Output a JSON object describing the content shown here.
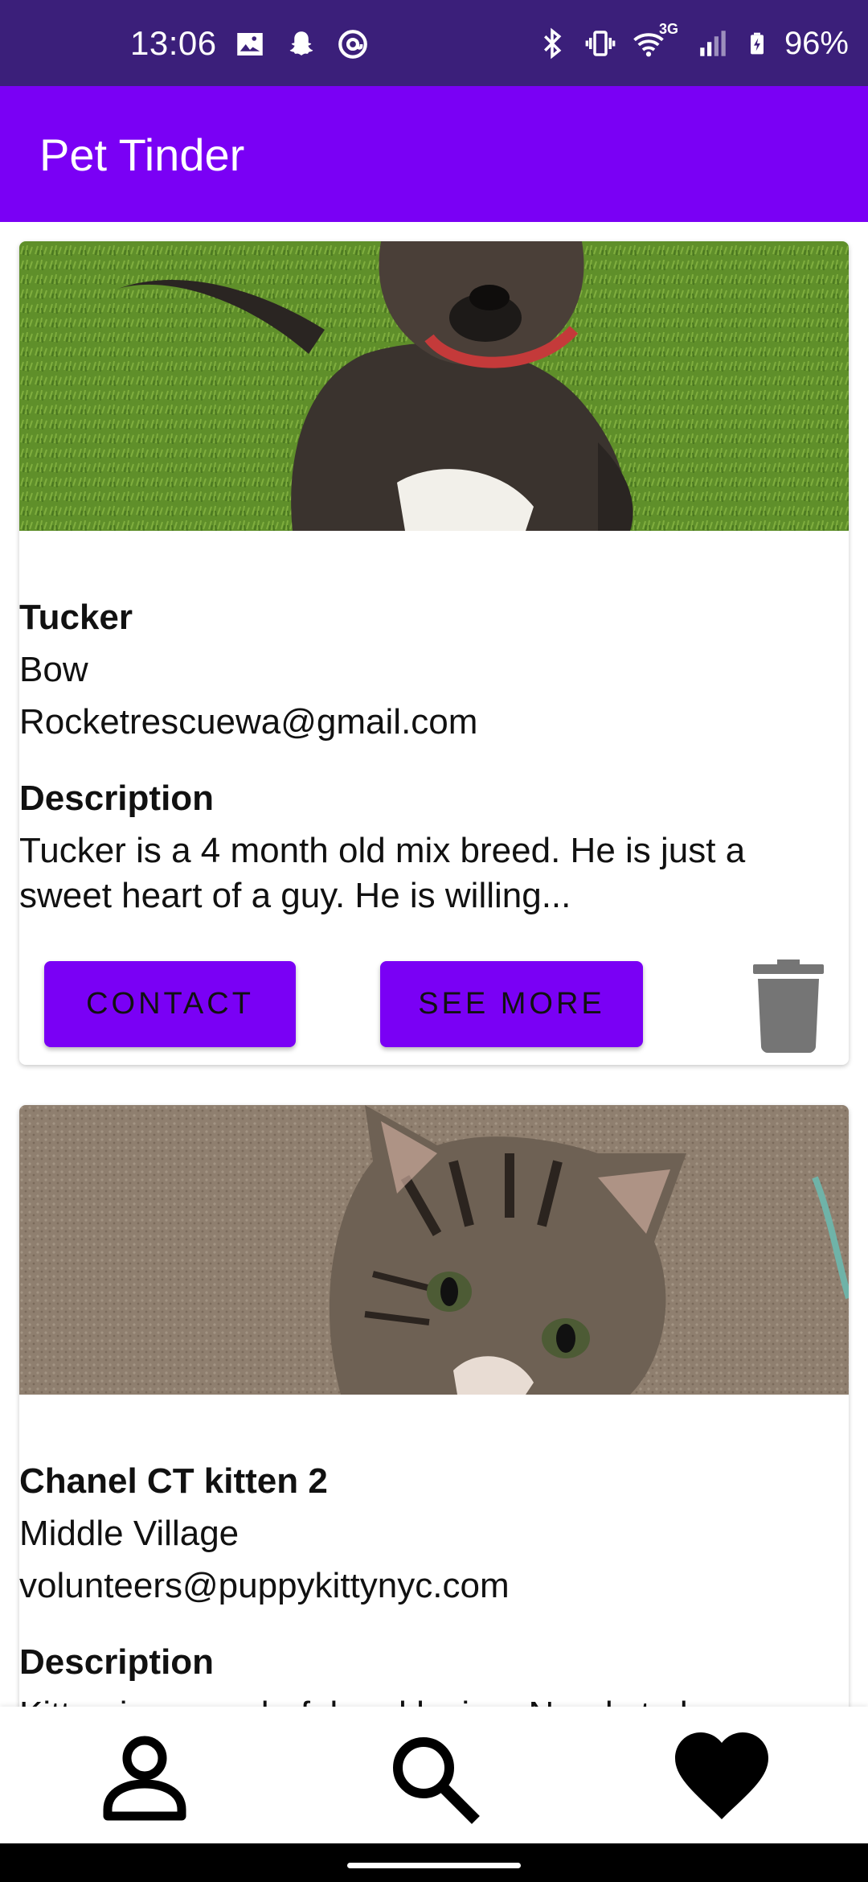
{
  "status_bar": {
    "time": "13:06",
    "battery": "96%",
    "network_label": "3G",
    "left_icons": [
      "image-icon",
      "snapchat-icon",
      "at-sign-icon"
    ],
    "right_icons": [
      "bluetooth-icon",
      "vibrate-icon",
      "wifi-icon",
      "signal-icon",
      "battery-charging-icon"
    ]
  },
  "app_bar": {
    "title": "Pet Tinder"
  },
  "cards": [
    {
      "name": "Tucker",
      "location": "Bow",
      "email": "Rocketrescuewa@gmail.com",
      "description_heading": "Description",
      "description": "Tucker is a 4 month old mix breed. He is just a sweet heart of a guy. He is willing...",
      "contact_label": "CONTACT",
      "see_more_label": "SEE MORE"
    },
    {
      "name": "Chanel CT kitten 2",
      "location": "Middle Village",
      "email": "volunteers@puppykittynyc.com",
      "description_heading": "Description",
      "description": "Kitten is a wonderful and loving. Needs to b"
    }
  ],
  "bottom_nav": {
    "items": [
      "profile-icon",
      "search-icon",
      "heart-icon"
    ]
  },
  "colors": {
    "status_bar": "#3b1f7a",
    "primary": "#7a00f5",
    "trash": "#757575"
  }
}
